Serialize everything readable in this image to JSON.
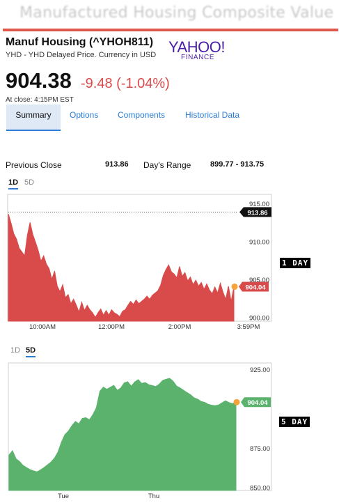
{
  "banner": {
    "title": "Manufactured Housing Composite Value"
  },
  "quote": {
    "name": "Manuf Housing (^YHOH811)",
    "subtitle": "YHD - YHD Delayed Price. Currency in USD",
    "price": "904.38",
    "change": "-9.48 (-1.04%)",
    "close_time": "At close: 4:15PM EST"
  },
  "logo": {
    "main": "YAHOO!",
    "sub": "FINANCE"
  },
  "tabs": [
    {
      "label": "Summary"
    },
    {
      "label": "Options"
    },
    {
      "label": "Components"
    },
    {
      "label": "Historical Data"
    }
  ],
  "stats": {
    "prev_close_label": "Previous Close",
    "prev_close_value": "913.86",
    "days_range_label": "Day's Range",
    "days_range_value": "899.77 - 913.75"
  },
  "range_toggles": {
    "one_day": "1D",
    "five_day": "5D"
  },
  "badges": {
    "one_day": "1 DAY",
    "five_day": "5 DAY"
  },
  "colors": {
    "down": "#d94b4b",
    "up": "#5bb26c",
    "accent": "#2a7dd7",
    "marker": "#f5a33a"
  },
  "chart_data": [
    {
      "type": "area",
      "period": "1D",
      "x_tick_labels": [
        "10:00AM",
        "12:00PM",
        "2:00PM",
        "3:59PM"
      ],
      "y_tick_labels": [
        "915.00",
        "910.00",
        "905.00",
        "900.00"
      ],
      "ylim": [
        899.5,
        916
      ],
      "reference_line": {
        "value": 913.86,
        "label": "913.86"
      },
      "last_value": {
        "value": 904.04,
        "label": "904.04"
      },
      "color": "#d94b4b",
      "x": [
        0,
        4,
        8,
        12,
        16,
        20,
        24,
        28,
        32,
        36,
        40,
        44,
        48,
        52,
        56,
        60,
        64,
        68,
        72,
        76,
        80,
        84,
        88,
        92,
        96,
        100,
        104,
        108,
        112,
        116,
        120,
        124,
        128,
        132,
        136,
        140,
        144,
        148,
        152,
        156,
        160,
        164,
        168,
        172,
        176,
        180,
        184,
        188,
        192,
        196,
        200,
        204,
        208,
        212,
        216,
        220,
        224,
        228,
        232,
        236,
        240,
        244,
        248,
        252,
        256,
        260,
        264,
        268,
        272,
        276,
        280,
        284,
        288,
        292,
        296,
        300,
        304,
        308,
        312,
        316,
        320,
        324,
        328,
        332
      ],
      "values": [
        913.6,
        912.4,
        911.0,
        910.3,
        909.1,
        908.6,
        908.1,
        910.8,
        912.5,
        910.9,
        909.9,
        908.8,
        907.4,
        908.1,
        907.0,
        906.4,
        905.0,
        906.1,
        904.1,
        903.4,
        904.3,
        902.6,
        903.0,
        901.8,
        902.4,
        901.6,
        900.7,
        902.0,
        900.9,
        901.6,
        901.0,
        900.6,
        900.0,
        900.6,
        901.1,
        900.3,
        900.9,
        900.3,
        901.0,
        900.6,
        900.4,
        900.1,
        900.8,
        901.0,
        901.6,
        902.1,
        901.7,
        902.3,
        901.8,
        902.1,
        902.4,
        902.8,
        902.4,
        902.9,
        903.2,
        903.5,
        904.2,
        905.5,
        906.3,
        906.9,
        906.0,
        905.7,
        905.2,
        906.7,
        905.4,
        905.9,
        904.8,
        905.3,
        904.3,
        904.9,
        904.1,
        904.6,
        903.7,
        904.4,
        903.6,
        903.1,
        904.0,
        903.2,
        904.5,
        903.3,
        902.4,
        904.1,
        902.1,
        904.04
      ]
    },
    {
      "type": "area",
      "period": "5D",
      "x_tick_labels": [
        "Tue",
        "Thu"
      ],
      "y_tick_labels": [
        "925.00",
        "875.00",
        "850.00"
      ],
      "ylim": [
        848,
        928
      ],
      "last_value": {
        "value": 904.04,
        "label": "904.04"
      },
      "color": "#5bb26c",
      "x": [
        0,
        5,
        10,
        15,
        20,
        25,
        30,
        35,
        40,
        45,
        50,
        55,
        60,
        65,
        70,
        75,
        80,
        85,
        90,
        95,
        100,
        105,
        110,
        115,
        120,
        125,
        130,
        135,
        140,
        145,
        150,
        155,
        160,
        165,
        170,
        175,
        180,
        185,
        190,
        195,
        200,
        205,
        210,
        215,
        220,
        225,
        230,
        235,
        240,
        245,
        250,
        255,
        260,
        265,
        270,
        275,
        280,
        285,
        290,
        295,
        300,
        305,
        310,
        315,
        320,
        325
      ],
      "values": [
        870.5,
        873.2,
        868.1,
        866.4,
        863.9,
        862.5,
        861.2,
        860.4,
        859.8,
        861.0,
        862.5,
        864.2,
        866.0,
        868.5,
        872.3,
        878.6,
        883.4,
        885.7,
        889.1,
        891.8,
        890.3,
        893.7,
        894.2,
        892.8,
        896.1,
        900.4,
        910.8,
        913.6,
        912.2,
        913.4,
        914.7,
        911.5,
        913.0,
        916.3,
        917.0,
        914.2,
        916.8,
        918.3,
        915.9,
        916.5,
        915.1,
        914.6,
        913.9,
        915.4,
        917.8,
        918.6,
        919.1,
        917.3,
        914.2,
        913.0,
        911.5,
        910.1,
        908.7,
        906.8,
        905.9,
        904.5,
        903.9,
        902.7,
        902.1,
        901.8,
        902.2,
        903.6,
        904.9,
        903.8,
        903.1,
        904.04
      ]
    }
  ]
}
